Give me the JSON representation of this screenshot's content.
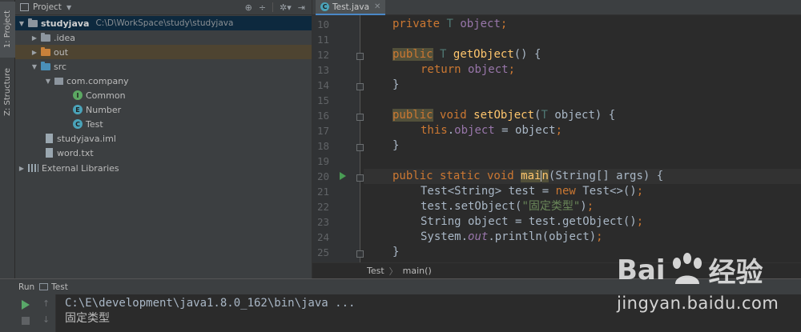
{
  "tool_stripe": {
    "project_tab": "1: Project",
    "structure_tab": "Z: Structure"
  },
  "project_panel": {
    "title": "Project",
    "tree": [
      {
        "label": "studyjava",
        "path": "C:\\D\\WorkSpace\\study\\studyjava"
      },
      {
        "label": ".idea"
      },
      {
        "label": "out"
      },
      {
        "label": "src"
      },
      {
        "label": "com.company"
      },
      {
        "label": "Common",
        "badge": "I"
      },
      {
        "label": "Number",
        "badge": "E"
      },
      {
        "label": "Test",
        "badge": "C"
      },
      {
        "label": "studyjava.iml"
      },
      {
        "label": "word.txt"
      },
      {
        "label": "External Libraries"
      }
    ]
  },
  "editor": {
    "tab_label": "Test.java",
    "line_numbers": [
      "10",
      "11",
      "12",
      "13",
      "14",
      "15",
      "16",
      "17",
      "18",
      "19",
      "20",
      "21",
      "22",
      "23",
      "24",
      "25"
    ],
    "code": {
      "l10": {
        "kw": "private",
        "type": "T",
        "field": "object",
        "end": ";"
      },
      "l12": {
        "kw": "public",
        "type": "T",
        "name": "getObject",
        "rest": "() {"
      },
      "l13": {
        "kw": "return",
        "field": "object",
        "end": ";"
      },
      "l14": "}",
      "l16": {
        "kw": "public",
        "kw2": "void",
        "name": "setObject",
        "open": "(",
        "type": "T",
        "rest": " object) {"
      },
      "l17": {
        "kw": "this",
        "dot": ".",
        "field": "object",
        "rest": " = object",
        "end": ";"
      },
      "l18": "}",
      "l20": {
        "kw": "public static void",
        "name_a": "mai",
        "name_b": "n",
        "rest": "(String[] args) {"
      },
      "l21": {
        "a": "Test<String> test = ",
        "kw": "new",
        "b": " Test<>()",
        "end": ";"
      },
      "l22": {
        "a": "test.setObject(",
        "str": "\"固定类型\"",
        "b": ")",
        "end": ";"
      },
      "l23": {
        "a": "String object = test.getObject()",
        "end": ";"
      },
      "l24": {
        "a": "System.",
        "st": "out",
        "b": ".println(object)",
        "end": ";"
      },
      "l25": "}"
    },
    "breadcrumb": {
      "class": "Test",
      "method": "main()"
    }
  },
  "run_panel": {
    "label": "Run",
    "config": "Test",
    "command": "C:\\E\\development\\java1.8.0_162\\bin\\java ...",
    "output": "固定类型"
  },
  "watermark": {
    "brand_a": "Bai",
    "brand_b": "经验",
    "url": "jingyan.baidu.com"
  },
  "colors": {
    "background": "#2b2b2b",
    "panel": "#3c3f41",
    "keyword": "#cc7832",
    "method": "#ffc66d",
    "field": "#9876aa",
    "string": "#6a8759"
  }
}
